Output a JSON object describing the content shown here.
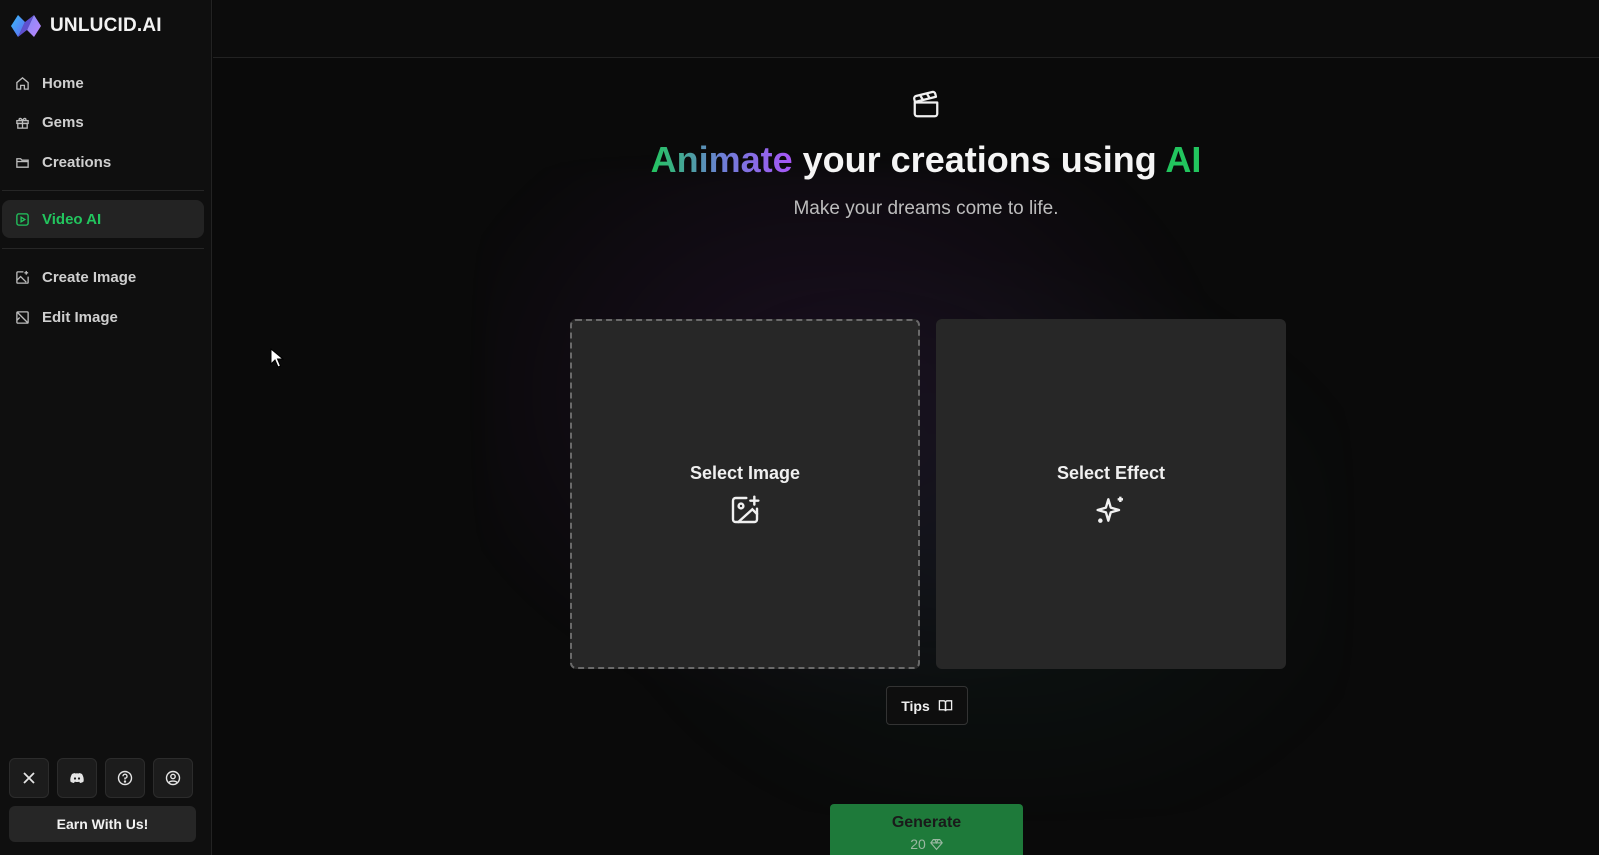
{
  "brand": {
    "name": "UNLUCID.AI"
  },
  "nav": {
    "home": "Home",
    "gems": "Gems",
    "creations": "Creations",
    "video_ai": "Video AI",
    "create_image": "Create Image",
    "edit_image": "Edit Image"
  },
  "footer": {
    "earn": "Earn With Us!"
  },
  "hero": {
    "word1": "Animate",
    "middle": " your creations using ",
    "word2": "AI",
    "subtitle": "Make your dreams come to life."
  },
  "cards": {
    "select_image": "Select Image",
    "select_effect": "Select Effect"
  },
  "tips": "Tips",
  "generate": {
    "label": "Generate",
    "cost": "20"
  },
  "colors": {
    "accent": "#22c55e",
    "active_bg": "#232323",
    "card_bg": "#272727",
    "generate_bg": "#1e7a3a"
  }
}
